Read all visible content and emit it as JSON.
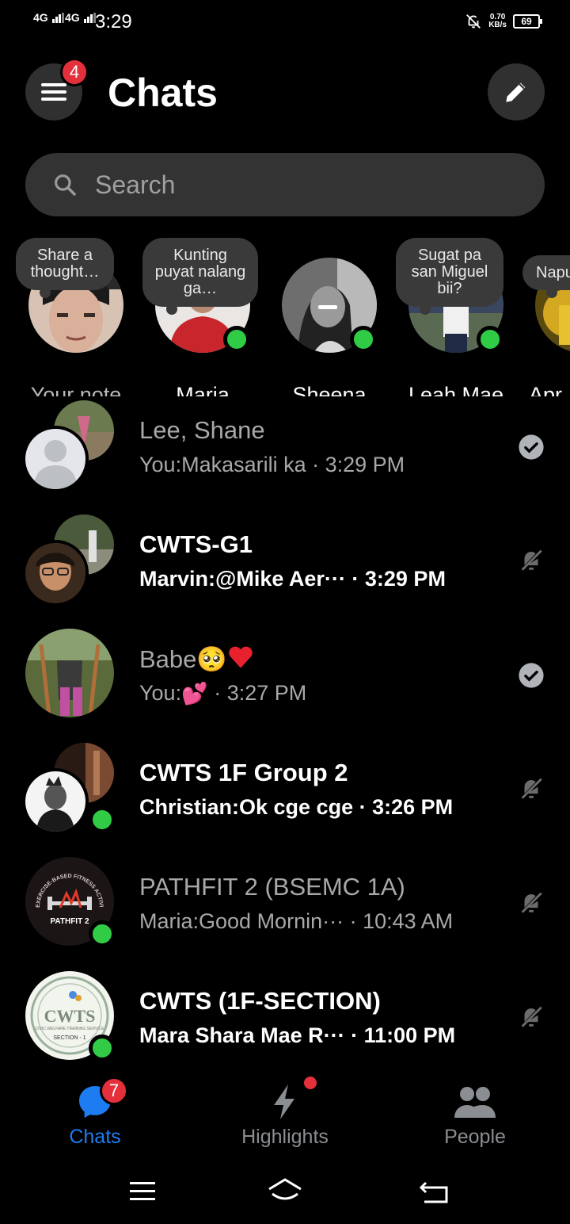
{
  "status_bar": {
    "sim1": "4G",
    "sim2": "4G",
    "time": "3:29",
    "net_speed_value": "0.70",
    "net_speed_unit": "KB/s",
    "battery": "69"
  },
  "header": {
    "title": "Chats",
    "menu_badge": "4",
    "menu_icon": "hamburger-icon",
    "compose_icon": "pencil-icon"
  },
  "search": {
    "placeholder": "Search"
  },
  "notes": [
    {
      "name": "Your note",
      "bubble": "Share a thought…",
      "online": false
    },
    {
      "name": "Maria",
      "bubble": "Kunting puyat nalang ga…",
      "online": true
    },
    {
      "name": "Sheena",
      "bubble": "",
      "online": true
    },
    {
      "name": "Leah Mae",
      "bubble": "Sugat pa san Miguel bii?",
      "online": true
    },
    {
      "name": "Apr",
      "bubble": "Napu",
      "online": false
    }
  ],
  "chats": [
    {
      "title": "Lee, Shane",
      "sender": "You:",
      "preview": " Makasarili ka",
      "sep": " · ",
      "time": "3:29 PM",
      "status_icon": "read-check-icon",
      "unread": false
    },
    {
      "title": "CWTS-G1",
      "sender": "Marvin:",
      "preview": " @Mike Aer···",
      "sep": " · ",
      "time": "3:29 PM",
      "status_icon": "muted-bell-icon",
      "unread": true
    },
    {
      "title": "Babe",
      "title_emoji": "🥺",
      "sender": "You:",
      "preview": " 💕",
      "sep": " · ",
      "time": "3:27 PM",
      "status_icon": "read-check-icon",
      "unread": false
    },
    {
      "title": "CWTS 1F Group 2",
      "sender": "Christian:",
      "preview": " Ok cge cge",
      "sep": " · ",
      "time": "3:26 PM",
      "status_icon": "muted-bell-icon",
      "unread": true
    },
    {
      "title": "PATHFIT 2 (BSEMC 1A)",
      "sender": "Maria:",
      "preview": " Good Mornin···",
      "sep": " · ",
      "time": "10:43 AM",
      "status_icon": "muted-bell-icon",
      "unread": false
    },
    {
      "title": "CWTS (1F-SECTION)",
      "sender": "Mara Shara Mae R···",
      "preview": "",
      "sep": " · ",
      "time": "11:00 PM",
      "status_icon": "muted-bell-icon",
      "unread": true
    }
  ],
  "avatar_text": {
    "pathfit_arc": "EXERCISE-BASED FITNESS ACTIVITIES",
    "pathfit_label": "PATHFIT 2",
    "cwts_logo": "CWTS",
    "cwts_sub": "CIVIC WELFARE TRAINING SERVICE",
    "cwts_section": "SECTION - 1"
  },
  "bottom_nav": {
    "tabs": [
      {
        "label": "Chats",
        "icon": "chat-bubble-icon",
        "badge": "7",
        "active": true
      },
      {
        "label": "Highlights",
        "icon": "lightning-icon",
        "dot": true,
        "active": false
      },
      {
        "label": "People",
        "icon": "people-icon",
        "active": false
      }
    ]
  },
  "colors": {
    "background": "#000000",
    "accent": "#1e7cf2",
    "badge": "#e4303a",
    "online": "#31cc46",
    "surface": "#303030"
  }
}
